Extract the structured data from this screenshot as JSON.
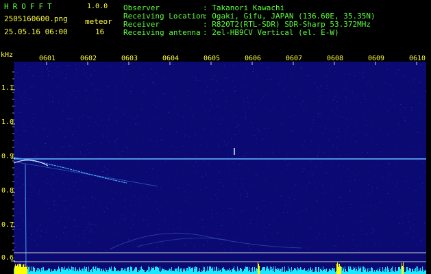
{
  "header": {
    "brand": "HROFFT",
    "version": "1.0.0",
    "filename": "2505160600.png",
    "meteor_label": "meteor",
    "datetime": "25.05.16 06:00",
    "meteor_count": "16"
  },
  "station": {
    "labels": [
      "Observer",
      "Receiving Location",
      "Receiver",
      "Receiving antenna"
    ],
    "values": [
      ": Takanori Kawachi",
      ": Ogaki, Gifu, JAPAN (136.60E, 35.35N)",
      ": R820T2(RTL-SDR) SDR-Sharp 53.372MHz",
      ": 2el-HB9CV Vertical (el. E-W)"
    ]
  },
  "axis": {
    "unit": "kHz",
    "time_ticks": [
      "0601",
      "0602",
      "0603",
      "0604",
      "0605",
      "0606",
      "0607",
      "0608",
      "0609",
      "0610"
    ],
    "freq_ticks": [
      "1.1",
      "1.0",
      "0.9",
      "0.8",
      "0.7",
      "0.6"
    ]
  },
  "colors": {
    "background": "#000000",
    "panel": "#0a0a72",
    "header_green": "#5cff3a",
    "header_yellow": "#ffff33",
    "signal": "#4aa8ff",
    "signal_bright": "#d8f2ff",
    "meter": "#19e8ff",
    "meter_peak": "#ffff00"
  }
}
